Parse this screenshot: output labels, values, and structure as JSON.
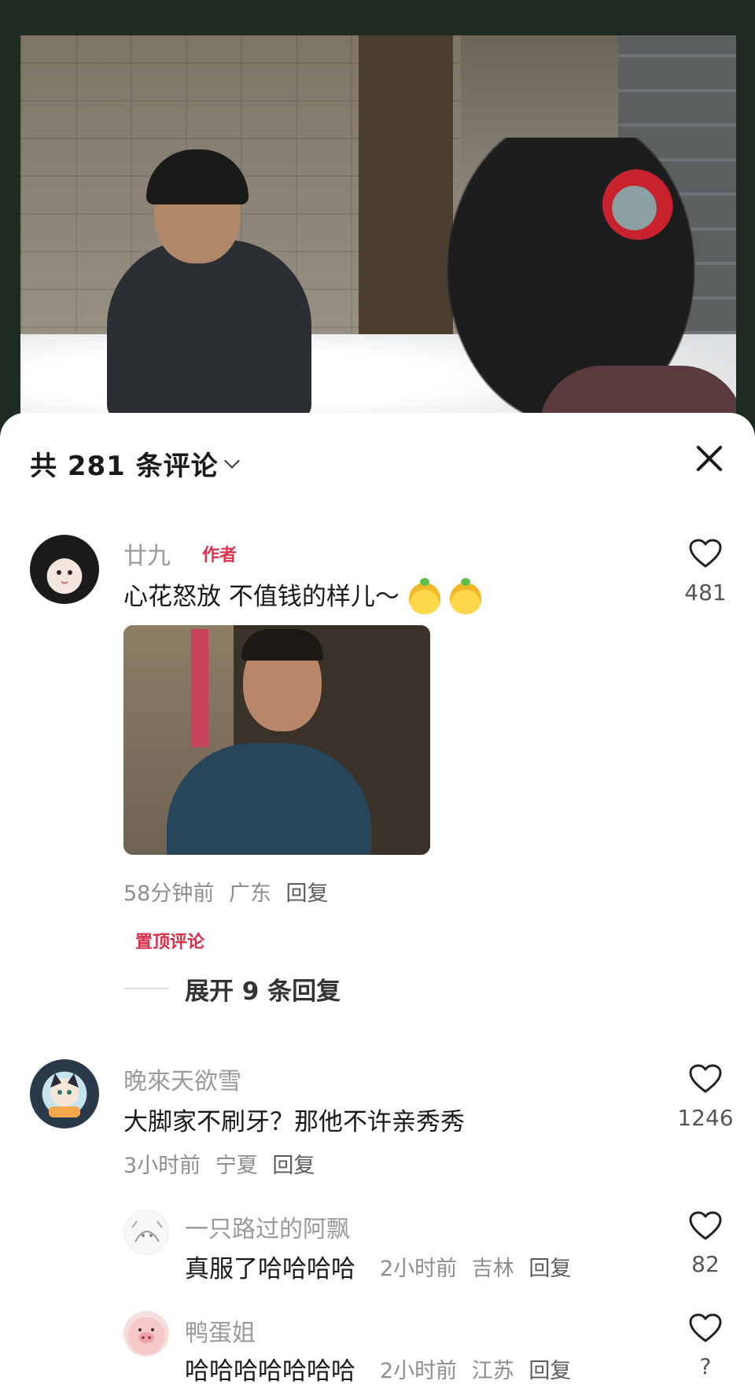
{
  "header": {
    "title": "共 281 条评论",
    "close_icon": "close-icon"
  },
  "comments": [
    {
      "user": "廿九",
      "tag": "作者",
      "text": "心花怒放 不值钱的样儿～",
      "emoji_icon": "pear-face-emoji",
      "time": "58分钟前",
      "location": "广东",
      "reply": "回复",
      "likes": "481",
      "pinned": "置顶评论",
      "expand": "展开 9 条回复"
    },
    {
      "user": "晚來天欲雪",
      "text": "大脚家不刷牙？那他不许亲秀秀",
      "time": "3小时前",
      "location": "宁夏",
      "reply": "回复",
      "likes": "1246",
      "replies": [
        {
          "user": "一只路过的阿飘",
          "text": "真服了哈哈哈哈",
          "time": "2小时前",
          "location": "吉林",
          "reply": "回复",
          "likes": "82"
        },
        {
          "user": "鸭蛋姐",
          "text": "哈哈哈哈哈哈哈",
          "time": "2小时前",
          "location": "江苏",
          "reply": "回复",
          "likes": "?"
        }
      ]
    }
  ],
  "colors": {
    "accent": "#e0334f",
    "text": "#1a1a1a",
    "muted": "#9a9a9a"
  }
}
